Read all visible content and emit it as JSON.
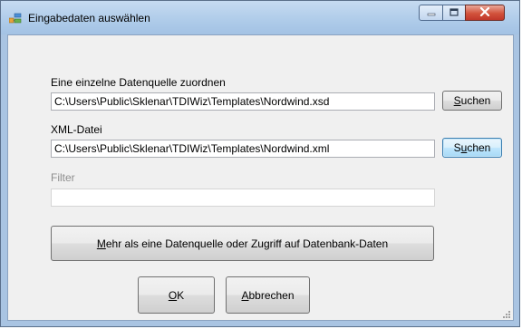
{
  "window": {
    "title": "Eingabedaten auswählen",
    "icon": "data-source-app-icon",
    "controls": [
      "minimize-icon",
      "maximize-icon",
      "close-icon"
    ],
    "accent": "#a9c4e2",
    "close_color": "#c0372a"
  },
  "single_source": {
    "label": "Eine einzelne Datenquelle zuordnen",
    "value": "C:\\Users\\Public\\Sklenar\\TDIWiz\\Templates\\Nordwind.xsd",
    "button": {
      "mnemonic": "S",
      "rest": "uchen"
    }
  },
  "xml_file": {
    "label": "XML-Datei",
    "value": "C:\\Users\\Public\\Sklenar\\TDIWiz\\Templates\\Nordwind.xml",
    "button": {
      "before": "S",
      "mnemonic": "u",
      "rest": "chen"
    }
  },
  "filter": {
    "label": "Filter",
    "value": ""
  },
  "multi_source_button": {
    "mnemonic": "M",
    "rest": "ehr als eine Datenquelle oder Zugriff auf Datenbank-Daten"
  },
  "ok_button": {
    "mnemonic": "O",
    "rest": "K"
  },
  "cancel_button": {
    "mnemonic": "A",
    "rest": "bbrechen"
  }
}
